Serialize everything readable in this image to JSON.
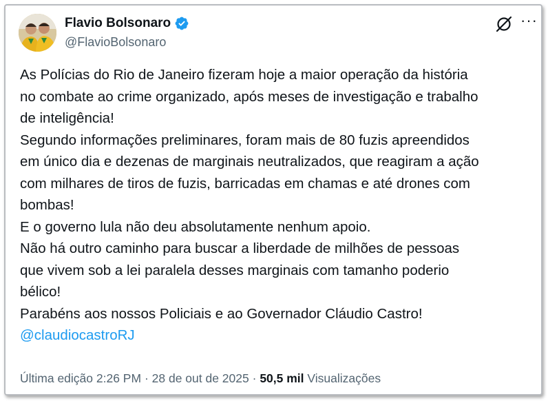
{
  "author": {
    "display_name": "Flavio Bolsonaro",
    "handle": "@FlavioBolsonaro"
  },
  "tweet": {
    "lines": [
      "As Polícias do Rio de Janeiro fizeram hoje a maior operação da história",
      "no combate ao crime organizado, após meses de investigação e trabalho",
      "de inteligência!",
      "Segundo informações preliminares, foram mais de 80 fuzis apreendidos",
      "em único dia e dezenas de marginais neutralizados, que reagiram a ação",
      "com milhares de tiros de fuzis, barricadas em chamas e até drones com",
      "bombas!",
      "E o governo lula não deu absolutamente nenhum apoio.",
      "Não há outro caminho para buscar a liberdade de milhões de pessoas",
      "que vivem sob a lei paralela desses marginais com tamanho poderio",
      "bélico!",
      "Parabéns aos nossos Policiais e ao Governador Cláudio Castro!"
    ],
    "mention": "@claudiocastroRJ"
  },
  "meta": {
    "edited_label": "Última edição 2:26 PM",
    "separator": "·",
    "date": "28 de out de 2025",
    "views_count": "50,5 mil",
    "views_label": "Visualizações"
  },
  "icons": {
    "verified": "verified-badge-icon",
    "x_logo": "x-logo-icon",
    "more": "more-options-icon"
  },
  "colors": {
    "text": "#0f1419",
    "secondary": "#536471",
    "accent": "#1d9bf0"
  }
}
